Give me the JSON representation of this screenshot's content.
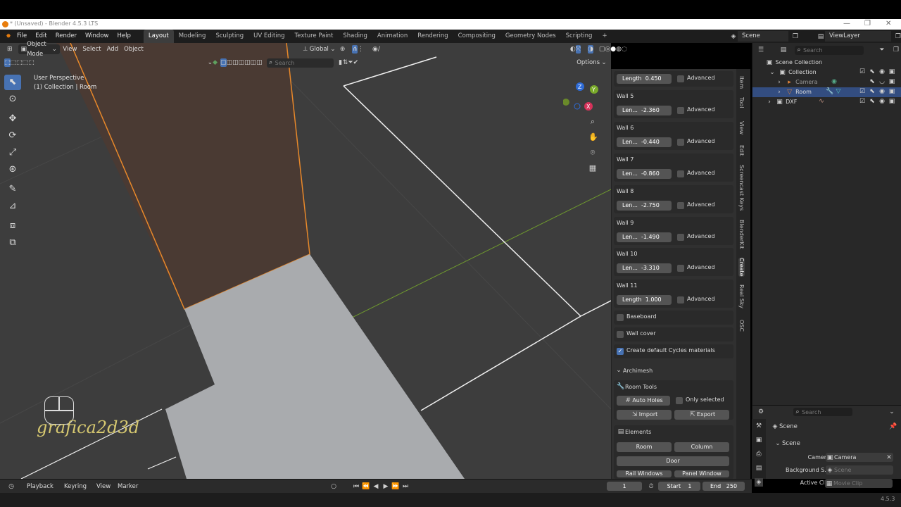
{
  "window": {
    "title": "* (Unsaved) - Blender 4.5.3 LTS",
    "controls": [
      "—",
      "❐",
      "✕"
    ]
  },
  "menu": {
    "items": [
      "File",
      "Edit",
      "Render",
      "Window",
      "Help"
    ],
    "workspaces": [
      "Layout",
      "Modeling",
      "Sculpting",
      "UV Editing",
      "Texture Paint",
      "Shading",
      "Animation",
      "Rendering",
      "Compositing",
      "Geometry Nodes",
      "Scripting"
    ],
    "active_workspace": "Layout",
    "add_workspace": "+",
    "scene": "Scene",
    "view_layer": "ViewLayer"
  },
  "viewport_header": {
    "mode": "Object Mode",
    "menus": [
      "View",
      "Select",
      "Add",
      "Object"
    ],
    "orientation": "Global",
    "options": "Options",
    "search_placeholder": "Search"
  },
  "viewport": {
    "perspective": "User Perspective",
    "context": "(1) Collection | Room",
    "watermark": "grafica2d3d",
    "gizmo": {
      "x": "X",
      "y": "Y",
      "z": "Z"
    }
  },
  "npanel": {
    "walls": [
      {
        "title": "",
        "label": "Length",
        "value": "0.450"
      },
      {
        "title": "Wall 5",
        "label": "Len...",
        "value": "-2.360"
      },
      {
        "title": "Wall 6",
        "label": "Len...",
        "value": "-0.440"
      },
      {
        "title": "Wall 7",
        "label": "Len...",
        "value": "-0.860"
      },
      {
        "title": "Wall 8",
        "label": "Len...",
        "value": "-2.750"
      },
      {
        "title": "Wall 9",
        "label": "Len...",
        "value": "-1.490"
      },
      {
        "title": "Wall 10",
        "label": "Len...",
        "value": "-3.310"
      },
      {
        "title": "Wall 11",
        "label": "Length",
        "value": "1.000"
      }
    ],
    "advanced_label": "Advanced",
    "baseboard": "Baseboard",
    "wall_cover": "Wall cover",
    "create_materials": "Create default Cycles materials",
    "archimesh": "Archimesh",
    "room_tools": "Room Tools",
    "auto_holes": "Auto Holes",
    "only_selected": "Only selected",
    "import": "Import",
    "export": "Export",
    "elements": "Elements",
    "room": "Room",
    "column": "Column",
    "door": "Door",
    "rail_windows": "Rail Windows",
    "panel_window": "Panel Window",
    "tabs": [
      "Item",
      "Tool",
      "View",
      "Edit",
      "Screencast Keys",
      "BlenderKit",
      "Create",
      "Real Sky",
      "OSC"
    ],
    "active_tab": "Create"
  },
  "outliner": {
    "search_placeholder": "Search",
    "rows": [
      {
        "label": "Scene Collection",
        "indent": 0
      },
      {
        "label": "Collection",
        "indent": 1
      },
      {
        "label": "Camera",
        "indent": 2
      },
      {
        "label": "Room",
        "indent": 2
      },
      {
        "label": "DXF",
        "indent": 1
      }
    ]
  },
  "properties": {
    "search_placeholder": "Search",
    "scene_title": "Scene",
    "section": "Scene",
    "camera_label": "Camera",
    "camera_value": "Camera",
    "background_label": "Background S...",
    "background_value": "Scene",
    "active_clip_label": "Active Clip",
    "active_clip_value": "Movie Clip"
  },
  "timeline": {
    "menus": [
      "Playback",
      "Keyring",
      "View",
      "Marker"
    ],
    "current_frame": "1",
    "start_label": "Start",
    "start_value": "1",
    "end_label": "End",
    "end_value": "250"
  },
  "status": {
    "version": "4.5.3"
  },
  "colors": {
    "selection_orange": "#e8882a",
    "accent_blue": "#4772b3",
    "viewport_bg": "#3d3d3d"
  }
}
